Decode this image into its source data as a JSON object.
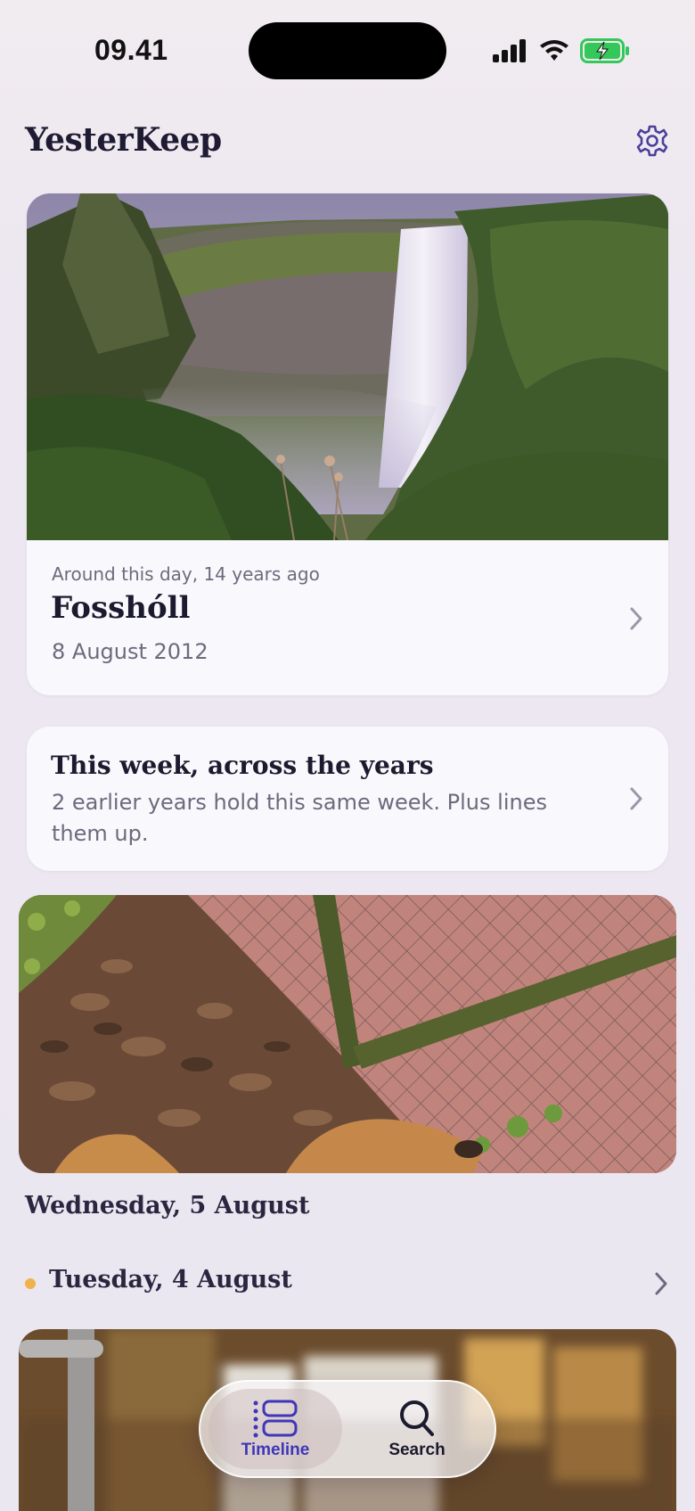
{
  "status_bar": {
    "time": "09.41"
  },
  "header": {
    "title": "YesterKeep",
    "settings_icon": "gear-icon"
  },
  "memory_card": {
    "eyebrow": "Around this day, 14 years ago",
    "place": "Fosshóll",
    "date": "8 August 2012"
  },
  "week_card": {
    "title": "This week, across the years",
    "description": "2 earlier years hold this same week. Plus lines them up."
  },
  "timeline": {
    "day_1": "Wednesday, 5 August",
    "day_2": "Tuesday, 4 August"
  },
  "tabbar": {
    "tabs": [
      {
        "label": "Timeline",
        "icon": "timeline-icon",
        "selected": true
      },
      {
        "label": "Search",
        "icon": "search-icon",
        "selected": false
      }
    ]
  },
  "colors": {
    "accent": "#3f36b8",
    "dot": "#f0b24a",
    "text": "#1c1a2e",
    "muted": "#6d6a7d"
  }
}
